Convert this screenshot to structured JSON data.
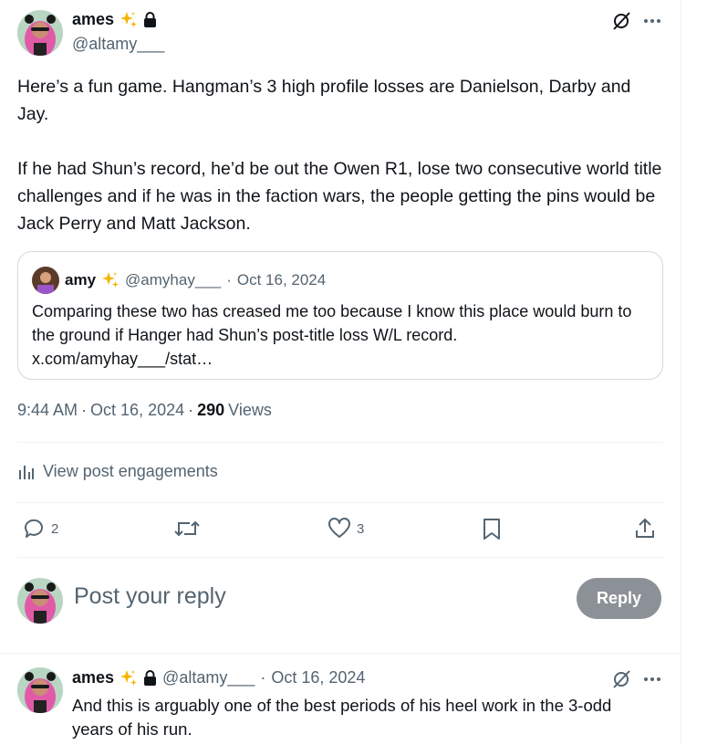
{
  "tweet": {
    "author_name": "ames",
    "author_handle": "@altamy___",
    "text": "Here’s a fun game. Hangman’s 3 high profile losses are Danielson, Darby and Jay.\n\nIf he had Shun’s record, he’d be out the Owen R1, lose two consecutive world title challenges and if he was in the faction wars, the people getting the pins would be Jack Perry and Matt Jackson.",
    "time": "9:44 AM",
    "date": "Oct 16, 2024",
    "views_count": "290",
    "views_label": "Views"
  },
  "quote": {
    "author_name": "amy",
    "author_handle": "@amyhay___",
    "date": "Oct 16, 2024",
    "text": "Comparing these two has creased me too because I know this place would burn to the ground if Hanger had Shun’s post-title loss W/L record.\nx.com/amyhay___/stat…"
  },
  "engagements_link": "View post engagements",
  "actions": {
    "reply_count": "2",
    "retweet_count": "",
    "like_count": "3"
  },
  "reply_composer": {
    "placeholder": "Post your reply",
    "button_label": "Reply"
  },
  "reply": {
    "author_name": "ames",
    "author_handle": "@altamy___",
    "date": "Oct 16, 2024",
    "text": "And this is arguably one of the best periods of his heel work in the 3-odd years of his run."
  },
  "colors": {
    "text_primary": "#0f1419",
    "text_secondary": "#536471",
    "border": "#cfd9de",
    "reply_button_disabled": "#8b9196"
  }
}
